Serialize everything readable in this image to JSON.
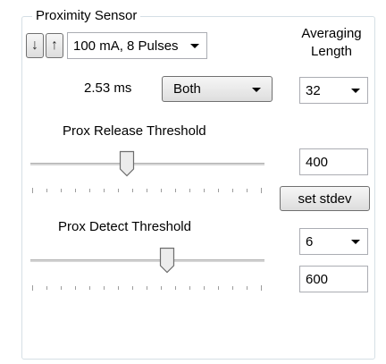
{
  "group": {
    "title": "Proximity Sensor"
  },
  "arrows": {
    "down_glyph": "↓",
    "up_glyph": "↑"
  },
  "led_current": {
    "selected": "100 mA, 8 Pulses"
  },
  "averaging": {
    "label_line1": "Averaging",
    "label_line2": "Length",
    "selected": "32"
  },
  "timing": {
    "value_text": "2.53 ms",
    "mode_selected": "Both"
  },
  "release_threshold": {
    "label": "Prox Release Threshold",
    "value": "400",
    "slider_level": 0.41
  },
  "stdev": {
    "button_label": "set stdev",
    "selected": "6"
  },
  "detect_threshold": {
    "label": "Prox Detect Threshold",
    "value": "600",
    "slider_level": 0.6
  },
  "colors": {
    "border": "#abadb3",
    "group_border": "#d5dfe5",
    "button_face": "#e5e5e5"
  }
}
